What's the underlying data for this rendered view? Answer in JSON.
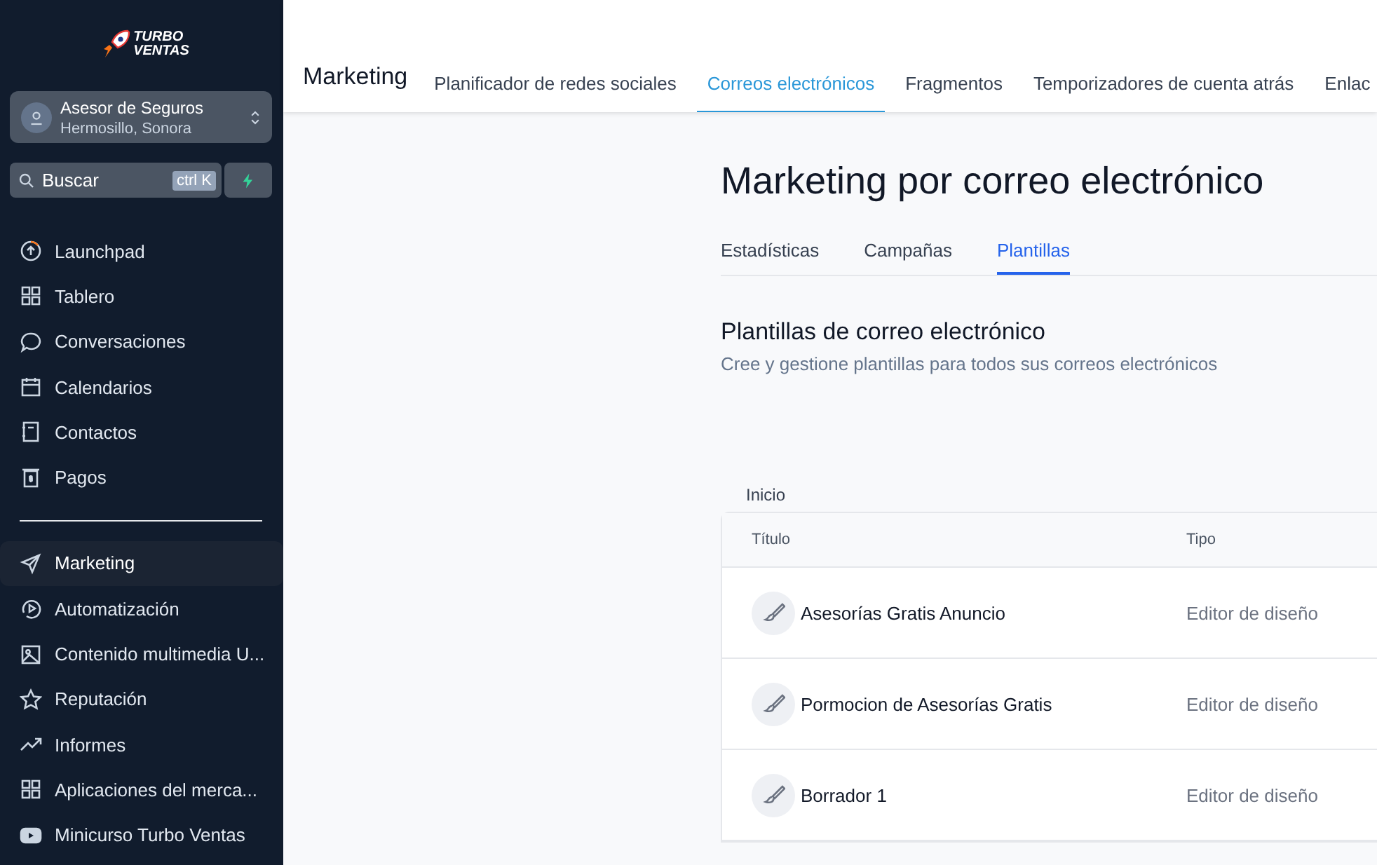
{
  "sidebar": {
    "logo": {
      "line_1": "TURBO",
      "line_2": "VENTAS"
    },
    "account": {
      "name": "Asesor de Seguros",
      "location": "Hermosillo, Sonora"
    },
    "search": {
      "placeholder": "Buscar",
      "shortcut": "ctrl K"
    },
    "groups": [
      [
        {
          "label": "Launchpad",
          "selected": false
        },
        {
          "label": "Tablero",
          "selected": false
        },
        {
          "label": "Conversaciones",
          "selected": false
        },
        {
          "label": "Calendarios",
          "selected": false
        },
        {
          "label": "Contactos",
          "selected": false
        },
        {
          "label": "Pagos",
          "selected": false
        }
      ],
      [
        {
          "label": "Marketing",
          "selected": true
        },
        {
          "label": "Automatización",
          "selected": false
        },
        {
          "label": "Contenido multimedia U...",
          "selected": false
        },
        {
          "label": "Reputación",
          "selected": false
        },
        {
          "label": "Informes",
          "selected": false
        },
        {
          "label": "Aplicaciones del merca...",
          "selected": false
        },
        {
          "label": "Minicurso Turbo Ventas",
          "selected": false
        }
      ]
    ]
  },
  "top_bar": {
    "title": "Marketing",
    "tabs": [
      {
        "label": "Planificador de redes sociales",
        "selected": false
      },
      {
        "label": "Correos electrónicos",
        "selected": true
      },
      {
        "label": "Fragmentos",
        "selected": false
      },
      {
        "label": "Temporizadores de cuenta atrás",
        "selected": false
      },
      {
        "label": "Enlac",
        "selected": false
      }
    ]
  },
  "page": {
    "title": "Marketing por correo electrónico",
    "tabs": [
      {
        "label": "Estadísticas",
        "selected": false
      },
      {
        "label": "Campañas",
        "selected": false
      },
      {
        "label": "Plantillas",
        "selected": true
      }
    ],
    "section_title": "Plantillas de correo electrónico",
    "section_subtitle": "Cree y gestione plantillas para todos sus correos electrónicos",
    "breadcrumb": "Inicio",
    "table": {
      "columns": [
        "Título",
        "Tipo"
      ],
      "rows": [
        {
          "title": "Asesorías Gratis Anuncio",
          "type": "Editor de diseño"
        },
        {
          "title": "Pormocion de Asesorías Gratis",
          "type": "Editor de diseño"
        },
        {
          "title": "Borrador 1",
          "type": "Editor de diseño"
        }
      ]
    }
  }
}
